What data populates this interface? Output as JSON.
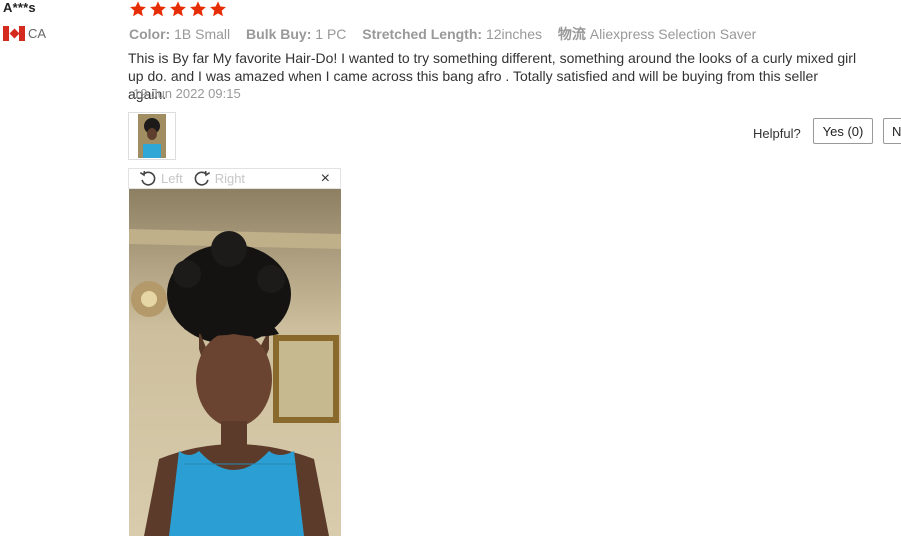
{
  "review": {
    "user_name": "A***s",
    "country_code": "CA",
    "rating": 5,
    "star_color": "#e62e04",
    "attributes": [
      {
        "label": "Color:",
        "value": "1B Small"
      },
      {
        "label": "Bulk Buy:",
        "value": "1 PC"
      },
      {
        "label": "Stretched Length:",
        "value": "12inches"
      },
      {
        "label": "物流",
        "value": "Aliexpress Selection Saver"
      }
    ],
    "text": "This is By far My favorite Hair-Do! I wanted to try something different, something around the looks of a curly mixed girl up do. and I was amazed when I came across this bang afro . Totally satisfied and will be buying from this seller again.",
    "date": "19 Jun 2022 09:15"
  },
  "helpful": {
    "label": "Helpful?",
    "yes_label": "Yes (0)",
    "no_label": "N"
  },
  "viewer": {
    "rotate_left_label": "Left",
    "rotate_right_label": "Right",
    "close_label": "×"
  }
}
